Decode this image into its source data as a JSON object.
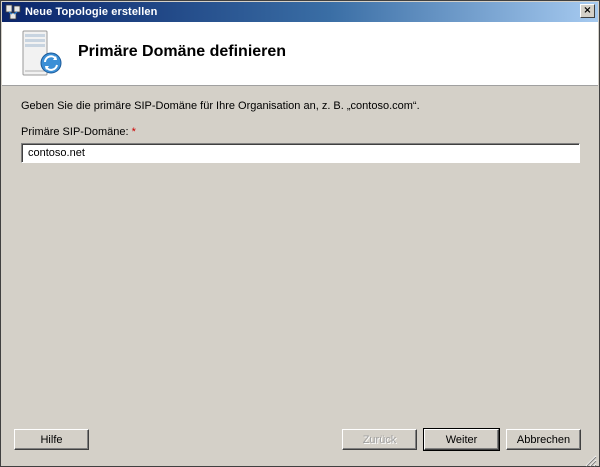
{
  "window": {
    "title": "Neue Topologie erstellen",
    "close_glyph": "×"
  },
  "header": {
    "title": "Primäre Domäne definieren",
    "icon": "server-sync-icon"
  },
  "form": {
    "instructions": "Geben Sie die primäre SIP-Domäne für Ihre Organisation an, z. B. „contoso.com“.",
    "label": "Primäre SIP-Domäne:",
    "required_marker": "*",
    "value": "contoso.net"
  },
  "buttons": {
    "help": "Hilfe",
    "back": "Zurück",
    "next": "Weiter",
    "cancel": "Abbrechen"
  },
  "colors": {
    "title_gradient_start": "#0a246a",
    "title_gradient_end": "#a6caf0",
    "dialog_background": "#d4d0c8",
    "required_color": "#cc0000"
  }
}
